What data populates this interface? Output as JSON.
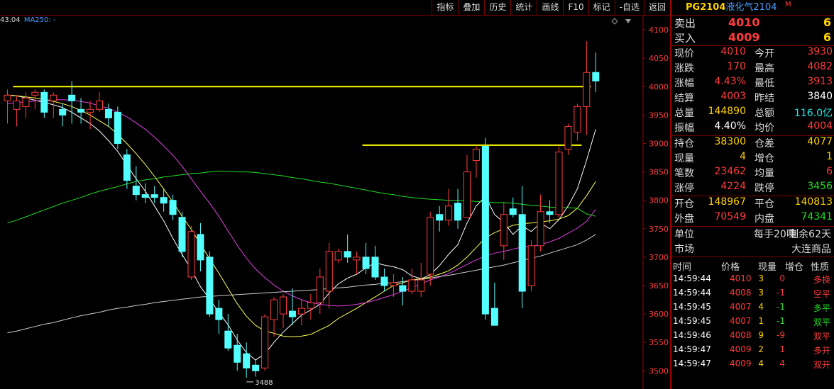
{
  "toolbar": {
    "buttons": [
      "指标",
      "叠加",
      "历史",
      "统计",
      "画线",
      "F10",
      "标记",
      "-自选",
      "返回"
    ]
  },
  "ma_legend": {
    "value": "43.04",
    "ma250": "MA250: -"
  },
  "low_label": "3488",
  "chart_data": {
    "type": "candlestick",
    "y_ticks": [
      4100,
      4050,
      4000,
      3950,
      3900,
      3850,
      3800,
      3750,
      3700,
      3650,
      3600,
      3550,
      3500
    ],
    "ylim": [
      3468,
      4125
    ],
    "candles": [
      [
        3975,
        3995,
        3985,
        3935
      ],
      [
        3960,
        3985,
        3975,
        3930
      ],
      [
        3965,
        3990,
        3980,
        3945
      ],
      [
        3985,
        3995,
        3990,
        3960
      ],
      [
        3990,
        3995,
        3955,
        3945
      ],
      [
        3975,
        3990,
        3985,
        3945
      ],
      [
        3960,
        3970,
        3950,
        3930
      ],
      [
        3985,
        4010,
        3975,
        3935
      ],
      [
        3960,
        3980,
        3955,
        3935
      ],
      [
        3955,
        3975,
        3960,
        3925
      ],
      [
        3960,
        3990,
        3975,
        3955
      ],
      [
        3960,
        3970,
        3945,
        3930
      ],
      [
        3955,
        3965,
        3900,
        3890
      ],
      [
        3880,
        3890,
        3835,
        3820
      ],
      [
        3825,
        3860,
        3810,
        3800
      ],
      [
        3810,
        3830,
        3805,
        3795
      ],
      [
        3810,
        3825,
        3805,
        3795
      ],
      [
        3805,
        3820,
        3795,
        3780
      ],
      [
        3800,
        3810,
        3775,
        3765
      ],
      [
        3770,
        3780,
        3710,
        3700
      ],
      [
        3665,
        3755,
        3745,
        3660
      ],
      [
        3740,
        3760,
        3695,
        3675
      ],
      [
        3700,
        3710,
        3600,
        3595
      ],
      [
        3610,
        3625,
        3590,
        3565
      ],
      [
        3570,
        3600,
        3540,
        3535
      ],
      [
        3545,
        3565,
        3515,
        3500
      ],
      [
        3530,
        3550,
        3505,
        3488
      ],
      [
        3510,
        3520,
        3500,
        3490
      ],
      [
        3505,
        3600,
        3595,
        3500
      ],
      [
        3590,
        3630,
        3625,
        3560
      ],
      [
        3600,
        3635,
        3630,
        3575
      ],
      [
        3605,
        3645,
        3595,
        3580
      ],
      [
        3600,
        3625,
        3610,
        3580
      ],
      [
        3610,
        3635,
        3620,
        3590
      ],
      [
        3620,
        3680,
        3665,
        3600
      ],
      [
        3640,
        3725,
        3710,
        3610
      ],
      [
        3695,
        3715,
        3710,
        3690
      ],
      [
        3710,
        3740,
        3700,
        3690
      ],
      [
        3695,
        3710,
        3700,
        3670
      ],
      [
        3700,
        3725,
        3680,
        3670
      ],
      [
        3700,
        3720,
        3665,
        3660
      ],
      [
        3665,
        3680,
        3650,
        3640
      ],
      [
        3650,
        3670,
        3655,
        3630
      ],
      [
        3650,
        3665,
        3640,
        3615
      ],
      [
        3640,
        3680,
        3660,
        3635
      ],
      [
        3640,
        3690,
        3660,
        3630
      ],
      [
        3670,
        3780,
        3770,
        3650
      ],
      [
        3775,
        3790,
        3765,
        3745
      ],
      [
        3765,
        3820,
        3790,
        3755
      ],
      [
        3795,
        3820,
        3765,
        3750
      ],
      [
        3770,
        3880,
        3850,
        3770
      ],
      [
        3870,
        3895,
        3890,
        3840
      ],
      [
        3895,
        3910,
        3600,
        3590
      ],
      [
        3610,
        3655,
        3580,
        3580
      ],
      [
        3720,
        3795,
        3775,
        3695
      ],
      [
        3785,
        3805,
        3775,
        3770
      ],
      [
        3775,
        3825,
        3640,
        3610
      ],
      [
        3650,
        3730,
        3720,
        3640
      ],
      [
        3720,
        3810,
        3780,
        3710
      ],
      [
        3780,
        3800,
        3775,
        3760
      ],
      [
        3775,
        3895,
        3885,
        3770
      ],
      [
        3890,
        3935,
        3930,
        3880
      ],
      [
        3920,
        3970,
        3965,
        3905
      ],
      [
        3965,
        4080,
        4025,
        3915
      ],
      [
        4025,
        4060,
        4010,
        3990
      ]
    ],
    "ma": [
      {
        "color": "#ffffff",
        "values": [
          3985,
          3984,
          3980,
          3976,
          3972,
          3968,
          3963,
          3955,
          3945,
          3935,
          3922,
          3905,
          3886,
          3862,
          3838,
          3816,
          3790,
          3764,
          3733,
          3705,
          3678,
          3648,
          3626,
          3603,
          3581,
          3554,
          3532,
          3519,
          3530,
          3550,
          3568,
          3583,
          3598,
          3607,
          3617,
          3637,
          3653,
          3663,
          3670,
          3681,
          3690,
          3686,
          3683,
          3678,
          3667,
          3662,
          3669,
          3685,
          3705,
          3722,
          3760,
          3790,
          3807,
          3775,
          3761,
          3740,
          3755,
          3745,
          3760,
          3750,
          3766,
          3790,
          3820,
          3870,
          3925
        ]
      },
      {
        "color": "#ffff55",
        "values": [
          3985,
          3984,
          3982,
          3980,
          3977,
          3974,
          3970,
          3965,
          3958,
          3950,
          3940,
          3930,
          3916,
          3900,
          3882,
          3863,
          3842,
          3820,
          3797,
          3772,
          3749,
          3723,
          3697,
          3672,
          3645,
          3618,
          3596,
          3580,
          3570,
          3566,
          3561,
          3560,
          3561,
          3564,
          3572,
          3580,
          3592,
          3601,
          3610,
          3620,
          3630,
          3640,
          3650,
          3655,
          3660,
          3662,
          3665,
          3670,
          3676,
          3686,
          3700,
          3717,
          3734,
          3743,
          3750,
          3756,
          3759,
          3760,
          3762,
          3764,
          3767,
          3773,
          3786,
          3808,
          3833
        ]
      },
      {
        "color": "#e23ee2",
        "values": [
          3970,
          3972,
          3973,
          3975,
          3976,
          3977,
          3977,
          3976,
          3974,
          3971,
          3966,
          3962,
          3955,
          3947,
          3936,
          3925,
          3911,
          3896,
          3879,
          3860,
          3838,
          3816,
          3795,
          3772,
          3746,
          3721,
          3698,
          3679,
          3664,
          3651,
          3640,
          3632,
          3625,
          3620,
          3617,
          3615,
          3614,
          3615,
          3617,
          3620,
          3624,
          3629,
          3634,
          3640,
          3646,
          3653,
          3660,
          3665,
          3671,
          3679,
          3687,
          3695,
          3702,
          3707,
          3710,
          3714,
          3718,
          3719,
          3722,
          3727,
          3733,
          3742,
          3751,
          3763,
          3784
        ]
      },
      {
        "color": "#22dd22",
        "values": [
          3760,
          3765,
          3771,
          3777,
          3783,
          3789,
          3795,
          3800,
          3805,
          3811,
          3816,
          3820,
          3824,
          3829,
          3833,
          3836,
          3838,
          3841,
          3843,
          3845,
          3847,
          3848,
          3850,
          3851,
          3851,
          3850,
          3850,
          3849,
          3847,
          3845,
          3843,
          3840,
          3838,
          3835,
          3832,
          3830,
          3827,
          3824,
          3821,
          3818,
          3815,
          3812,
          3810,
          3807,
          3805,
          3803,
          3802,
          3801,
          3800,
          3800,
          3799,
          3798,
          3797,
          3796,
          3796,
          3795,
          3793,
          3791,
          3790,
          3788,
          3787,
          3787,
          3786,
          3776,
          3772
        ]
      },
      {
        "color": "#cccccc",
        "values": [
          3567,
          3570,
          3574,
          3578,
          3582,
          3585,
          3589,
          3593,
          3597,
          3600,
          3603,
          3607,
          3610,
          3612,
          3615,
          3617,
          3620,
          3622,
          3624,
          3626,
          3628,
          3630,
          3631,
          3632,
          3633,
          3634,
          3635,
          3636,
          3637,
          3638,
          3639,
          3640,
          3641,
          3642,
          3643,
          3645,
          3646,
          3647,
          3649,
          3651,
          3652,
          3654,
          3655,
          3657,
          3659,
          3661,
          3663,
          3666,
          3668,
          3671,
          3674,
          3677,
          3680,
          3683,
          3686,
          3690,
          3694,
          3698,
          3702,
          3707,
          3712,
          3717,
          3722,
          3730,
          3740
        ]
      }
    ],
    "hlines": [
      {
        "price": 4000,
        "from": 1,
        "to": 63,
        "color": "#ffff00"
      },
      {
        "price": 3897,
        "from": 39,
        "to": 62,
        "color": "#ffff00"
      }
    ]
  },
  "panel": {
    "code": "PG2104",
    "name": "液化气2104",
    "sup": "M",
    "sell": {
      "label": "卖出",
      "price": "4010",
      "vol": "6"
    },
    "buy": {
      "label": "买入",
      "price": "4009",
      "vol": "6"
    },
    "stats": [
      {
        "l1": "现价",
        "v1": "4010",
        "c1": "red",
        "l2": "今开",
        "v2": "3930",
        "c2": "red"
      },
      {
        "l1": "涨跌",
        "v1": "170",
        "c1": "red",
        "l2": "最高",
        "v2": "4082",
        "c2": "red"
      },
      {
        "l1": "涨幅",
        "v1": "4.43%",
        "c1": "red",
        "l2": "最低",
        "v2": "3913",
        "c2": "red"
      },
      {
        "l1": "结算",
        "v1": "4003",
        "c1": "red",
        "l2": "昨结",
        "v2": "3840",
        "c2": "white"
      },
      {
        "l1": "总量",
        "v1": "144890",
        "c1": "yellow",
        "l2": "总额",
        "v2": "116.0亿",
        "c2": "cyan"
      },
      {
        "l1": "振幅",
        "v1": "4.40%",
        "c1": "white",
        "l2": "均价",
        "v2": "4004",
        "c2": "red"
      }
    ],
    "stats2": [
      {
        "l1": "持仓",
        "v1": "38300",
        "c1": "yellow",
        "l2": "仓差",
        "v2": "4077",
        "c2": "yellow"
      },
      {
        "l1": "现量",
        "v1": "4",
        "c1": "yellow",
        "l2": "增仓",
        "v2": "1",
        "c2": "yellow"
      },
      {
        "l1": "笔数",
        "v1": "23462",
        "c1": "red",
        "l2": "均量",
        "v2": "6",
        "c2": "red"
      },
      {
        "l1": "涨停",
        "v1": "4224",
        "c1": "red",
        "l2": "跌停",
        "v2": "3456",
        "c2": "green"
      }
    ],
    "stats3": [
      {
        "l1": "开仓",
        "v1": "148967",
        "c1": "yellow",
        "l2": "平仓",
        "v2": "140813",
        "c2": "yellow"
      },
      {
        "l1": "外盘",
        "v1": "70549",
        "c1": "red",
        "l2": "内盘",
        "v2": "74341",
        "c2": "green"
      }
    ],
    "unit": {
      "label": "单位",
      "mid": "每手20吨",
      "right": "剩余62天"
    },
    "market": {
      "label": "市场",
      "right": "大连商品"
    },
    "ticks_head": [
      "时间",
      "价格",
      "现量",
      "增仓",
      "性质"
    ],
    "ticks": [
      {
        "t": "14:59:44",
        "p": "4010",
        "v": "3",
        "z": "0",
        "n": "多换",
        "zc": "red",
        "nc": "red"
      },
      {
        "t": "14:59:44",
        "p": "4008",
        "v": "3",
        "z": "-1",
        "n": "空平",
        "zc": "red",
        "nc": "red"
      },
      {
        "t": "14:59:45",
        "p": "4007",
        "v": "4",
        "z": "-1",
        "n": "多平",
        "zc": "green",
        "nc": "green"
      },
      {
        "t": "14:59:45",
        "p": "4007",
        "v": "1",
        "z": "-1",
        "n": "双平",
        "zc": "green",
        "nc": "green"
      },
      {
        "t": "14:59:46",
        "p": "4008",
        "v": "9",
        "z": "-9",
        "n": "双平",
        "zc": "red",
        "nc": "red"
      },
      {
        "t": "14:59:47",
        "p": "4009",
        "v": "2",
        "z": "1",
        "n": "多开",
        "zc": "red",
        "nc": "red"
      },
      {
        "t": "14:59:47",
        "p": "4009",
        "v": "4",
        "z": "4",
        "n": "双开",
        "zc": "red",
        "nc": "red"
      }
    ]
  }
}
